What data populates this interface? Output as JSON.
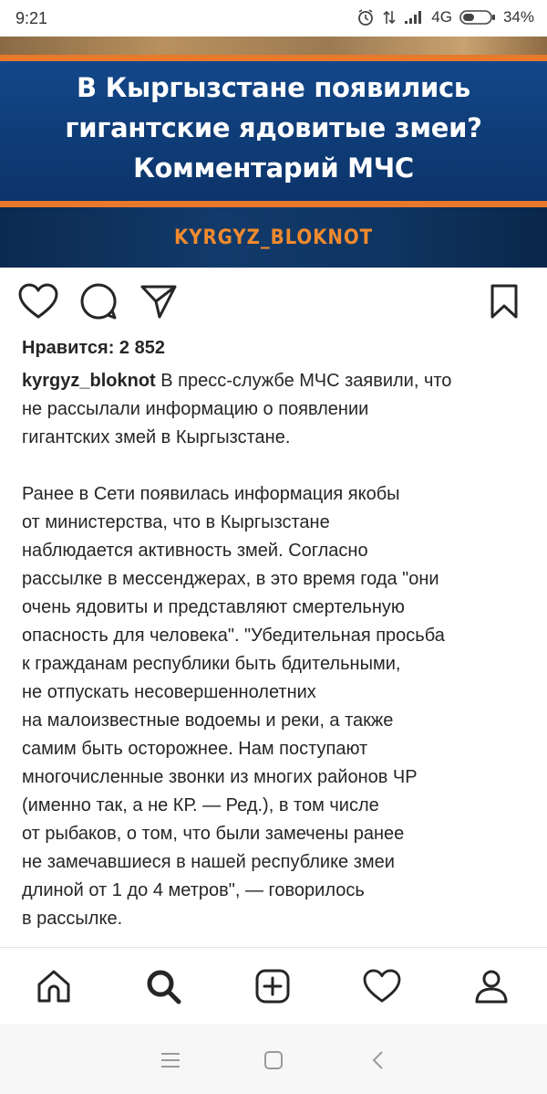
{
  "status_bar": {
    "time": "9:21",
    "network": "4G",
    "battery": "34%",
    "icons": [
      "alarm-icon",
      "data-arrows-icon",
      "signal-icon",
      "battery-icon"
    ]
  },
  "post_image": {
    "headline_lines": [
      "В Кыргызстане появились",
      "гигантские ядовитые змеи?",
      "Комментарий МЧС"
    ],
    "account_tag": "KYRGYZ_BLOKNOT",
    "colors": {
      "blue": "#13478a",
      "orange": "#e8792a",
      "white": "#ffffff"
    }
  },
  "actions": {
    "icons": [
      "heart-icon",
      "comment-icon",
      "share-icon",
      "bookmark-icon"
    ]
  },
  "post": {
    "likes": "Нравится: 2 852",
    "username": "kyrgyz_bloknot",
    "caption_first_line": " В пресс-службе МЧС заявили, что",
    "caption_lines_p1": [
      "не рассылали информацию о появлении",
      "гигантских змей в Кыргызстане."
    ],
    "caption_lines_p2": [
      "Ранее в Сети появилась информация якобы",
      "от министерства, что в Кыргызстане",
      "наблюдается активность змей. Согласно",
      "рассылке в мессенджерах, в это время года \"они",
      "очень ядовиты и представляют смертельную",
      "опасность для человека\". \"Убедительная просьба",
      "к гражданам республики быть бдительными,",
      "не отпускать несовершеннолетних",
      "на малоизвестные водоемы и реки, а также",
      "самим быть осторожнее. Нам поступают",
      "многочисленные звонки из многих районов ЧР",
      "(именно так, а не КР. — Ред.), в том числе",
      "от рыбаков, о том, что были замечены ранее",
      "не замечавшиеся в нашей республике змеи",
      "длиной от 1 до 4 метров\", — говорилось",
      "в рассылке."
    ]
  },
  "bottom_nav": {
    "items": [
      "home-icon",
      "search-icon",
      "add-post-icon",
      "activity-heart-icon",
      "profile-icon"
    ],
    "active": "search-icon"
  },
  "system_nav": {
    "items": [
      "menu-icon",
      "home-square-icon",
      "back-icon"
    ]
  }
}
